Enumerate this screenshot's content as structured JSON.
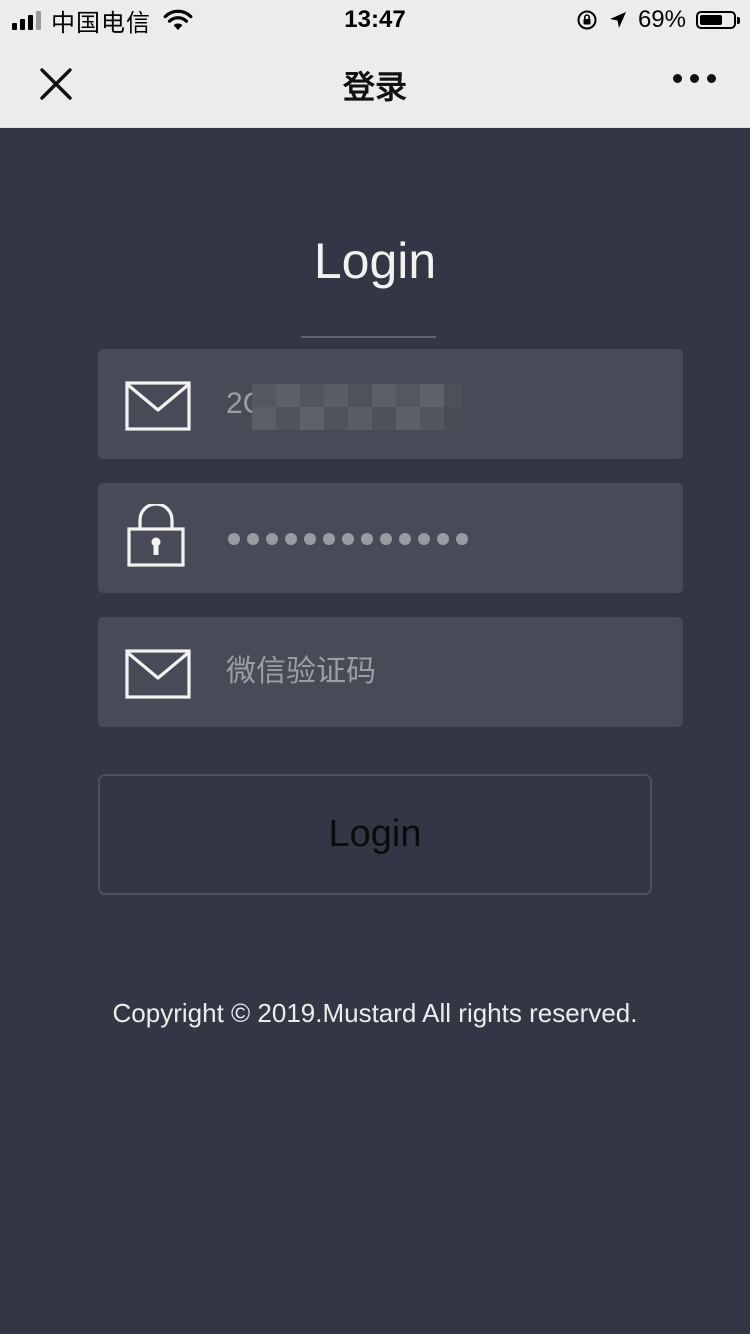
{
  "status_bar": {
    "carrier": "中国电信",
    "time": "13:47",
    "battery_percent": "69%",
    "battery_level": 0.69,
    "icons": [
      "signal-icon",
      "wifi-icon",
      "orientation-lock-icon",
      "location-arrow-icon",
      "battery-icon"
    ]
  },
  "nav": {
    "title": "登录",
    "close_icon": "close-icon",
    "more_icon": "more-icon"
  },
  "login_form": {
    "title": "Login",
    "email": {
      "icon": "mail-icon",
      "value": "2C"
    },
    "password": {
      "icon": "lock-icon",
      "masked_length": 13
    },
    "wechat_code": {
      "icon": "mail-icon",
      "placeholder": "微信验证码"
    },
    "submit_label": "Login"
  },
  "footer": {
    "copyright": "Copyright © 2019.Mustard All rights reserved."
  }
}
